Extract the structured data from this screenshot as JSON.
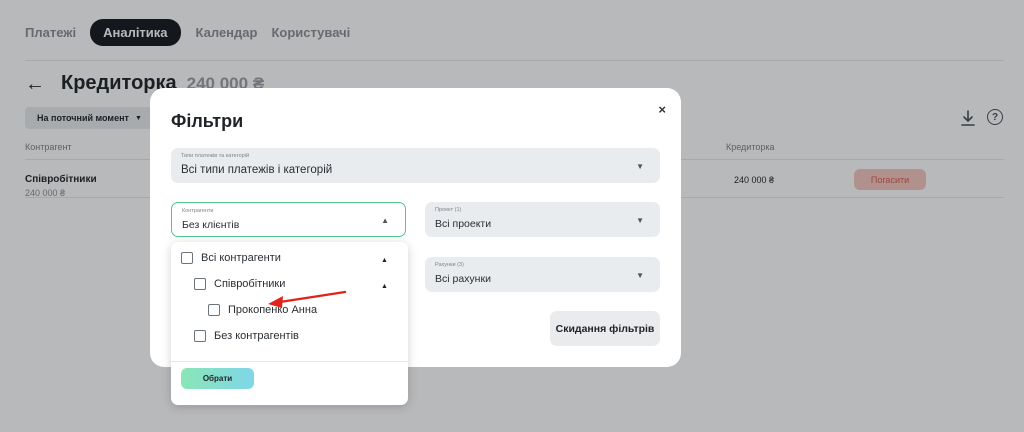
{
  "nav": {
    "tabs": [
      {
        "label": "Платежі",
        "active": false
      },
      {
        "label": "Аналітика",
        "active": true
      },
      {
        "label": "Календар",
        "active": false
      },
      {
        "label": "Користувачі",
        "active": false
      }
    ]
  },
  "header": {
    "title": "Кредиторка",
    "amount": "240 000 ₴",
    "back_icon": "arrow-left-icon"
  },
  "toolbar": {
    "moment_label": "На поточний момент",
    "download_icon": "download-icon",
    "help_icon": "help-icon",
    "help_glyph": "?"
  },
  "table": {
    "columns": [
      "Контрагент",
      "Кредиторка"
    ],
    "rows": [
      {
        "name": "Співробітники",
        "sub": "240 000 ₴",
        "amount": "240 000 ₴",
        "action": "Погасити"
      }
    ]
  },
  "modal": {
    "title": "Фільтри",
    "close_glyph": "×",
    "fields": {
      "types": {
        "label": "Типи платежів та категорій",
        "value": "Всі типи платежів і категорій"
      },
      "counterparties": {
        "label": "Контрагенти",
        "value": "Без клієнтів"
      },
      "project": {
        "label": "Проект (1)",
        "value": "Всі проекти"
      },
      "accounts": {
        "label": "Рахунки (3)",
        "value": "Всі рахунки"
      }
    },
    "reset_label": "Скидання фільтрів"
  },
  "dropdown": {
    "items": [
      {
        "label": "Всі контрагенти",
        "level": 0,
        "expanded": true,
        "checked": false
      },
      {
        "label": "Співробітники",
        "level": 1,
        "expanded": true,
        "checked": false
      },
      {
        "label": "Прокопенко Анна",
        "level": 2,
        "checked": false
      },
      {
        "label": "Без контрагентів",
        "level": 1,
        "checked": false
      }
    ],
    "select_label": "Обрати"
  },
  "colors": {
    "accent_green": "#4fc98b",
    "annotation_red": "#e0241b",
    "pay_button_bg": "#f5c6c0",
    "pay_button_text": "#e05a4b"
  }
}
